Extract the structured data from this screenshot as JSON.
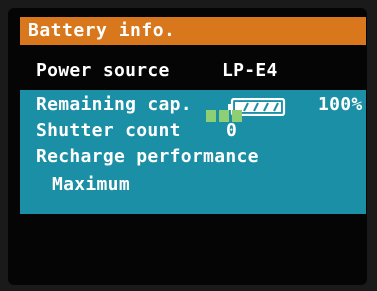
{
  "header": {
    "title": "Battery info."
  },
  "power_source": {
    "label": "Power source",
    "value": "LP-E4"
  },
  "remaining": {
    "label": "Remaining cap.",
    "percent": "100%",
    "fill_fraction": 1.0
  },
  "shutter": {
    "label": "Shutter count",
    "value": "0"
  },
  "recharge": {
    "label": "Recharge performance",
    "level_label": "Maximum",
    "bars_filled": 3,
    "bars_total": 3
  },
  "colors": {
    "title_bar": "#d8771c",
    "panel": "#1b8fa5",
    "bars": "#8fcf74"
  },
  "icons": {
    "battery": "battery-full-icon"
  }
}
